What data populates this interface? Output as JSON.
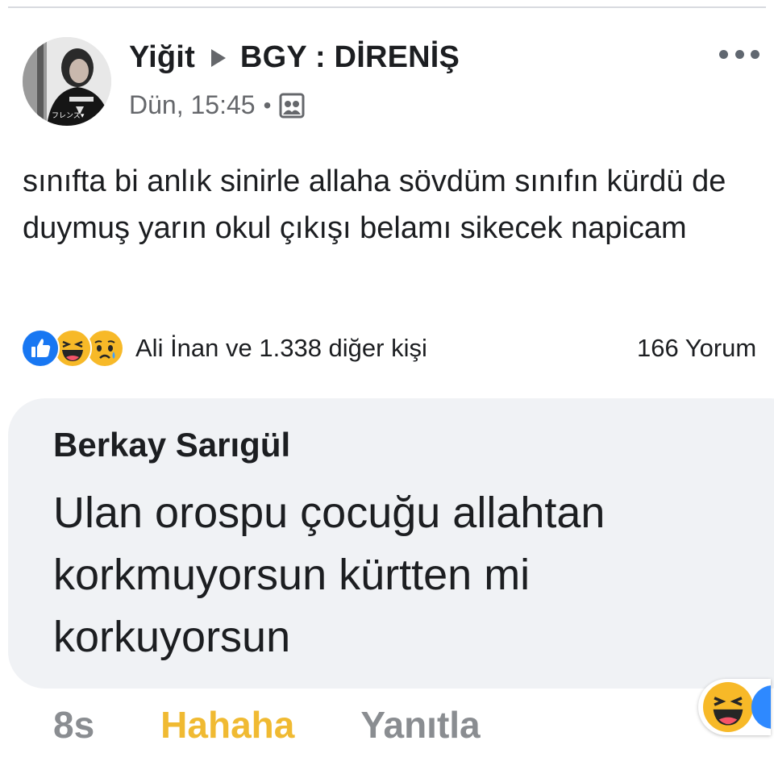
{
  "post": {
    "author": "Yiğit",
    "group": "BGY : DİRENİŞ",
    "timestamp": "Dün, 15:45",
    "meta_separator": "•",
    "privacy_icon": "group-privacy-icon",
    "avatar_badge": "フレンズ▾",
    "text": "sınıfta bi anlık sinirle allaha sövdüm sınıfın kürdü de duymuş yarın okul çıkışı belamı sikecek napicam"
  },
  "reactions": {
    "icons": [
      "like-icon",
      "haha-icon",
      "sad-icon"
    ],
    "summary": "Ali İnan ve 1.338 diğer kişi",
    "comments": "166 Yorum"
  },
  "comment": {
    "author": "Berkay Sarıgül",
    "text": "Ulan orospu çocuğu allahtan korkmuyorsun kürtten mi korkuyorsun",
    "time": "8s",
    "reaction_label": "Hahaha",
    "reply_label": "Yanıtla"
  },
  "colors": {
    "like": "#1877f2",
    "haha": "#f7b928",
    "haha_label": "#f0ba32",
    "secondary_text": "#65676b",
    "bubble": "#f0f2f5"
  }
}
